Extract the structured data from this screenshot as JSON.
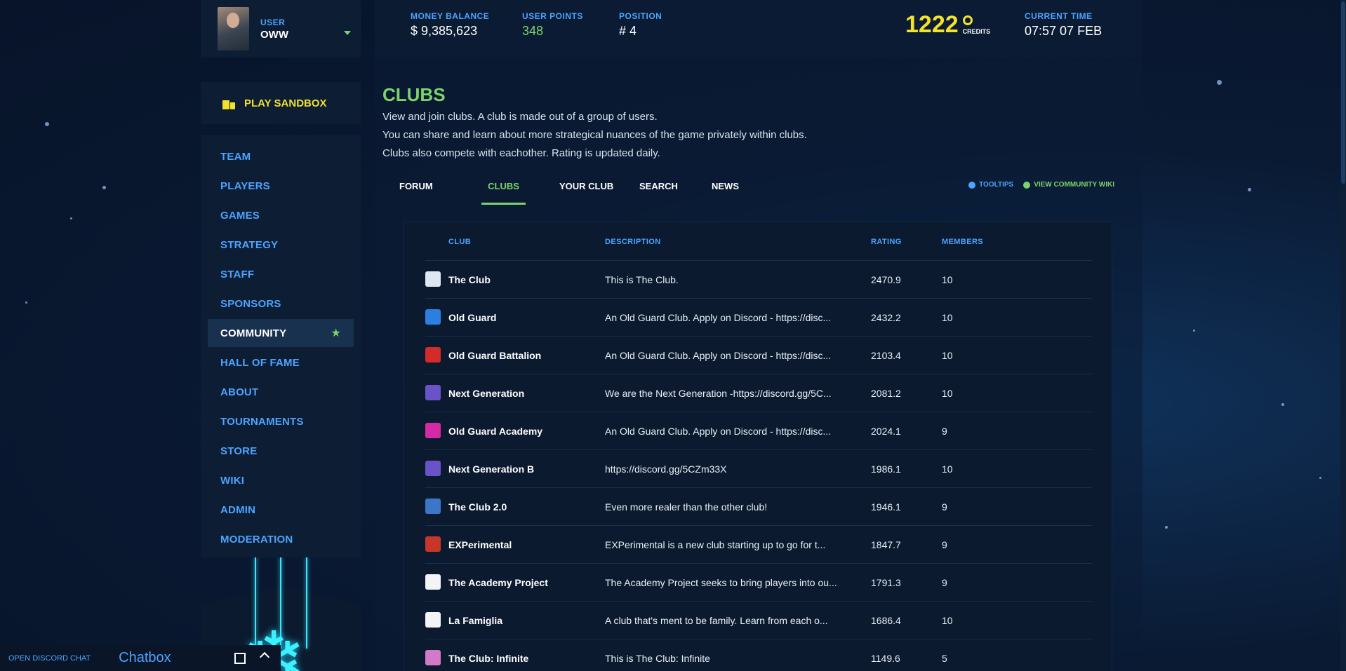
{
  "user": {
    "label": "USER",
    "name": "OWW"
  },
  "sandbox": {
    "label": "PLAY SANDBOX",
    "icon": "sandbox-icon"
  },
  "nav": [
    {
      "label": "TEAM",
      "active": false
    },
    {
      "label": "PLAYERS",
      "active": false
    },
    {
      "label": "GAMES",
      "active": false
    },
    {
      "label": "STRATEGY",
      "active": false
    },
    {
      "label": "STAFF",
      "active": false
    },
    {
      "label": "SPONSORS",
      "active": false
    },
    {
      "label": "COMMUNITY",
      "active": true,
      "icon": "star-icon"
    },
    {
      "label": "HALL OF FAME",
      "active": false
    },
    {
      "label": "ABOUT",
      "active": false
    },
    {
      "label": "TOURNAMENTS",
      "active": false
    },
    {
      "label": "STORE",
      "active": false
    },
    {
      "label": "WIKI",
      "active": false
    },
    {
      "label": "ADMIN",
      "active": false
    },
    {
      "label": "MODERATION",
      "active": false
    }
  ],
  "header": {
    "money": {
      "label": "MONEY BALANCE",
      "value": "$ 9,385,623"
    },
    "points": {
      "label": "USER POINTS",
      "value": "348"
    },
    "position": {
      "label": "POSITION",
      "value": "# 4"
    },
    "credits": {
      "value": "1222",
      "unit": "CREDITS"
    },
    "time": {
      "label": "CURRENT TIME",
      "value": "07:57 07 FEB"
    }
  },
  "page": {
    "title": "CLUBS",
    "desc": [
      "View and join clubs. A club is made out of a group of users.",
      "You can share and learn about more strategical nuances of the game privately within clubs.",
      "Clubs also compete with eachother. Rating is updated daily."
    ]
  },
  "tabs": [
    {
      "label": "FORUM",
      "active": false
    },
    {
      "label": "CLUBS",
      "active": true
    },
    {
      "label": "YOUR CLUB",
      "active": false
    },
    {
      "label": "SEARCH",
      "active": false
    },
    {
      "label": "NEWS",
      "active": false
    }
  ],
  "links": {
    "tooltips": "TOOLTIPS",
    "wiki": "VIEW COMMUNITY WIKI"
  },
  "table": {
    "columns": {
      "club": "CLUB",
      "description": "DESCRIPTION",
      "rating": "RATING",
      "members": "MEMBERS"
    },
    "rows": [
      {
        "club": "The Club",
        "description": "This is The Club.",
        "rating": "2470.9",
        "members": "10",
        "logo_color": "#dfe8f2"
      },
      {
        "club": "Old Guard",
        "description": "An Old Guard Club. Apply on Discord - https://disc...",
        "rating": "2432.2",
        "members": "10",
        "logo_color": "#2a7fe0"
      },
      {
        "club": "Old Guard Battalion",
        "description": "An Old Guard Club. Apply on Discord - https://disc...",
        "rating": "2103.4",
        "members": "10",
        "logo_color": "#d32a2a"
      },
      {
        "club": "Next Generation",
        "description": "We are the Next Generation -https://discord.gg/5C...",
        "rating": "2081.2",
        "members": "10",
        "logo_color": "#6a52c8"
      },
      {
        "club": "Old Guard Academy",
        "description": "An Old Guard Club. Apply on Discord - https://disc...",
        "rating": "2024.1",
        "members": "9",
        "logo_color": "#d52aa5"
      },
      {
        "club": "Next Generation B",
        "description": "https://discord.gg/5CZm33X",
        "rating": "1986.1",
        "members": "10",
        "logo_color": "#6a52c8"
      },
      {
        "club": "The Club 2.0",
        "description": "Even more realer than the other club!",
        "rating": "1946.1",
        "members": "9",
        "logo_color": "#3b76c8"
      },
      {
        "club": "EXPerimental",
        "description": "EXPerimental is a new club starting up to go for t...",
        "rating": "1847.7",
        "members": "9",
        "logo_color": "#c8362a"
      },
      {
        "club": "The Academy Project",
        "description": "The Academy Project seeks to bring players into ou...",
        "rating": "1791.3",
        "members": "9",
        "logo_color": "#f2f4f7"
      },
      {
        "club": "La Famiglia",
        "description": "A club that's ment to be family. Learn from each o...",
        "rating": "1686.4",
        "members": "10",
        "logo_color": "#f2f4f7"
      },
      {
        "club": "The Club: Infinite",
        "description": "This is The Club: Infinite",
        "rating": "1149.6",
        "members": "5",
        "logo_color": "#d27ac8"
      }
    ]
  },
  "chat": {
    "open": "OPEN DISCORD CHAT",
    "title": "Chatbox"
  },
  "colors": {
    "accent_blue": "#4da3ff",
    "accent_green": "#7dd36b",
    "accent_yellow": "#f2e22b",
    "panel": "#0c1d34"
  }
}
